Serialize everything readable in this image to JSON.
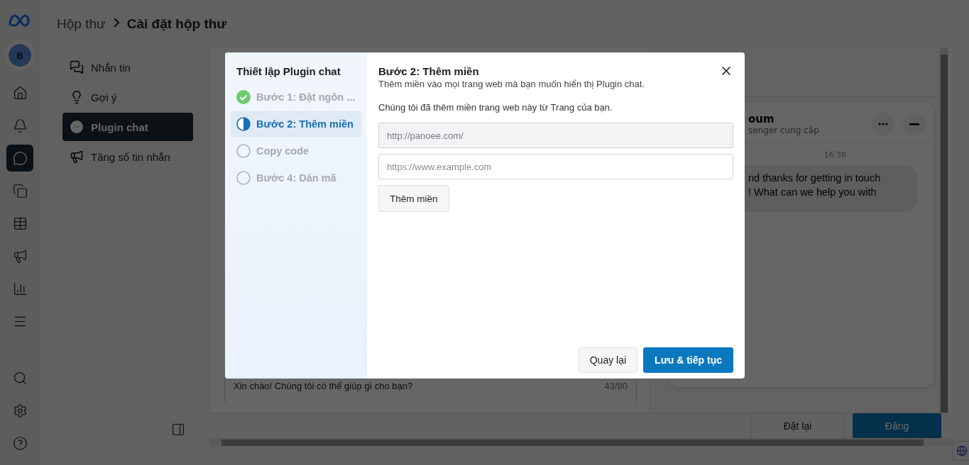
{
  "rail": {
    "avatar": "B",
    "items": [
      {
        "selected": false
      },
      {
        "selected": false
      },
      {
        "selected": true
      },
      {
        "selected": false
      },
      {
        "selected": false
      },
      {
        "selected": false
      },
      {
        "selected": false
      },
      {
        "selected": false
      }
    ]
  },
  "breadcrumb": {
    "parent": "Hộp thư",
    "current": "Cài đặt hộp thư"
  },
  "settings_menu": [
    {
      "label": "Nhắn tin",
      "selected": false
    },
    {
      "label": "Gợi ý",
      "selected": false
    },
    {
      "label": "Plugin chat",
      "selected": true
    },
    {
      "label": "Tăng số tin nhắn",
      "selected": false
    }
  ],
  "editor": {
    "greeting": "Xin chào! Chúng tôi có thể giúp gì cho bạn?",
    "counter": "43/80"
  },
  "preview": {
    "title": "oum",
    "subtitle": "senger cung cấp",
    "time": "16:36",
    "message_lines": [
      "nd thanks for getting in touch",
      "! What can we help you with"
    ]
  },
  "footer_buttons": [
    {
      "label": "Đặt lại",
      "primary": false
    },
    {
      "label": "Đăng",
      "primary": true
    }
  ],
  "dialog": {
    "sidebar_title": "Thiết lập Plugin chat",
    "steps": [
      {
        "label": "Bước 1: Đặt ngôn ...",
        "kind": "done",
        "selected": false
      },
      {
        "label": "Bước 2: Thêm miền",
        "kind": "current",
        "selected": true
      },
      {
        "label": "Copy code",
        "kind": "todo",
        "selected": false
      },
      {
        "label": "Bước 4: Dán mã",
        "kind": "todo",
        "selected": false
      }
    ],
    "title": "Bước 2: Thêm miền",
    "subtitle": "Thêm miền vào mọi trang web mà bạn muốn hiển thị Plugin chat.",
    "note": "Chúng tôi đã thêm miền trang web này từ Trang của bạn.",
    "existing_domain": {
      "value": "http://panoee.com/",
      "disabled": true
    },
    "new_domain": {
      "placeholder": "https://www.example.com"
    },
    "add_button": "Thêm miền",
    "buttons": [
      {
        "label": "Quay lại",
        "primary": false
      },
      {
        "label": "Lưu & tiếp tục",
        "primary": true
      }
    ]
  }
}
